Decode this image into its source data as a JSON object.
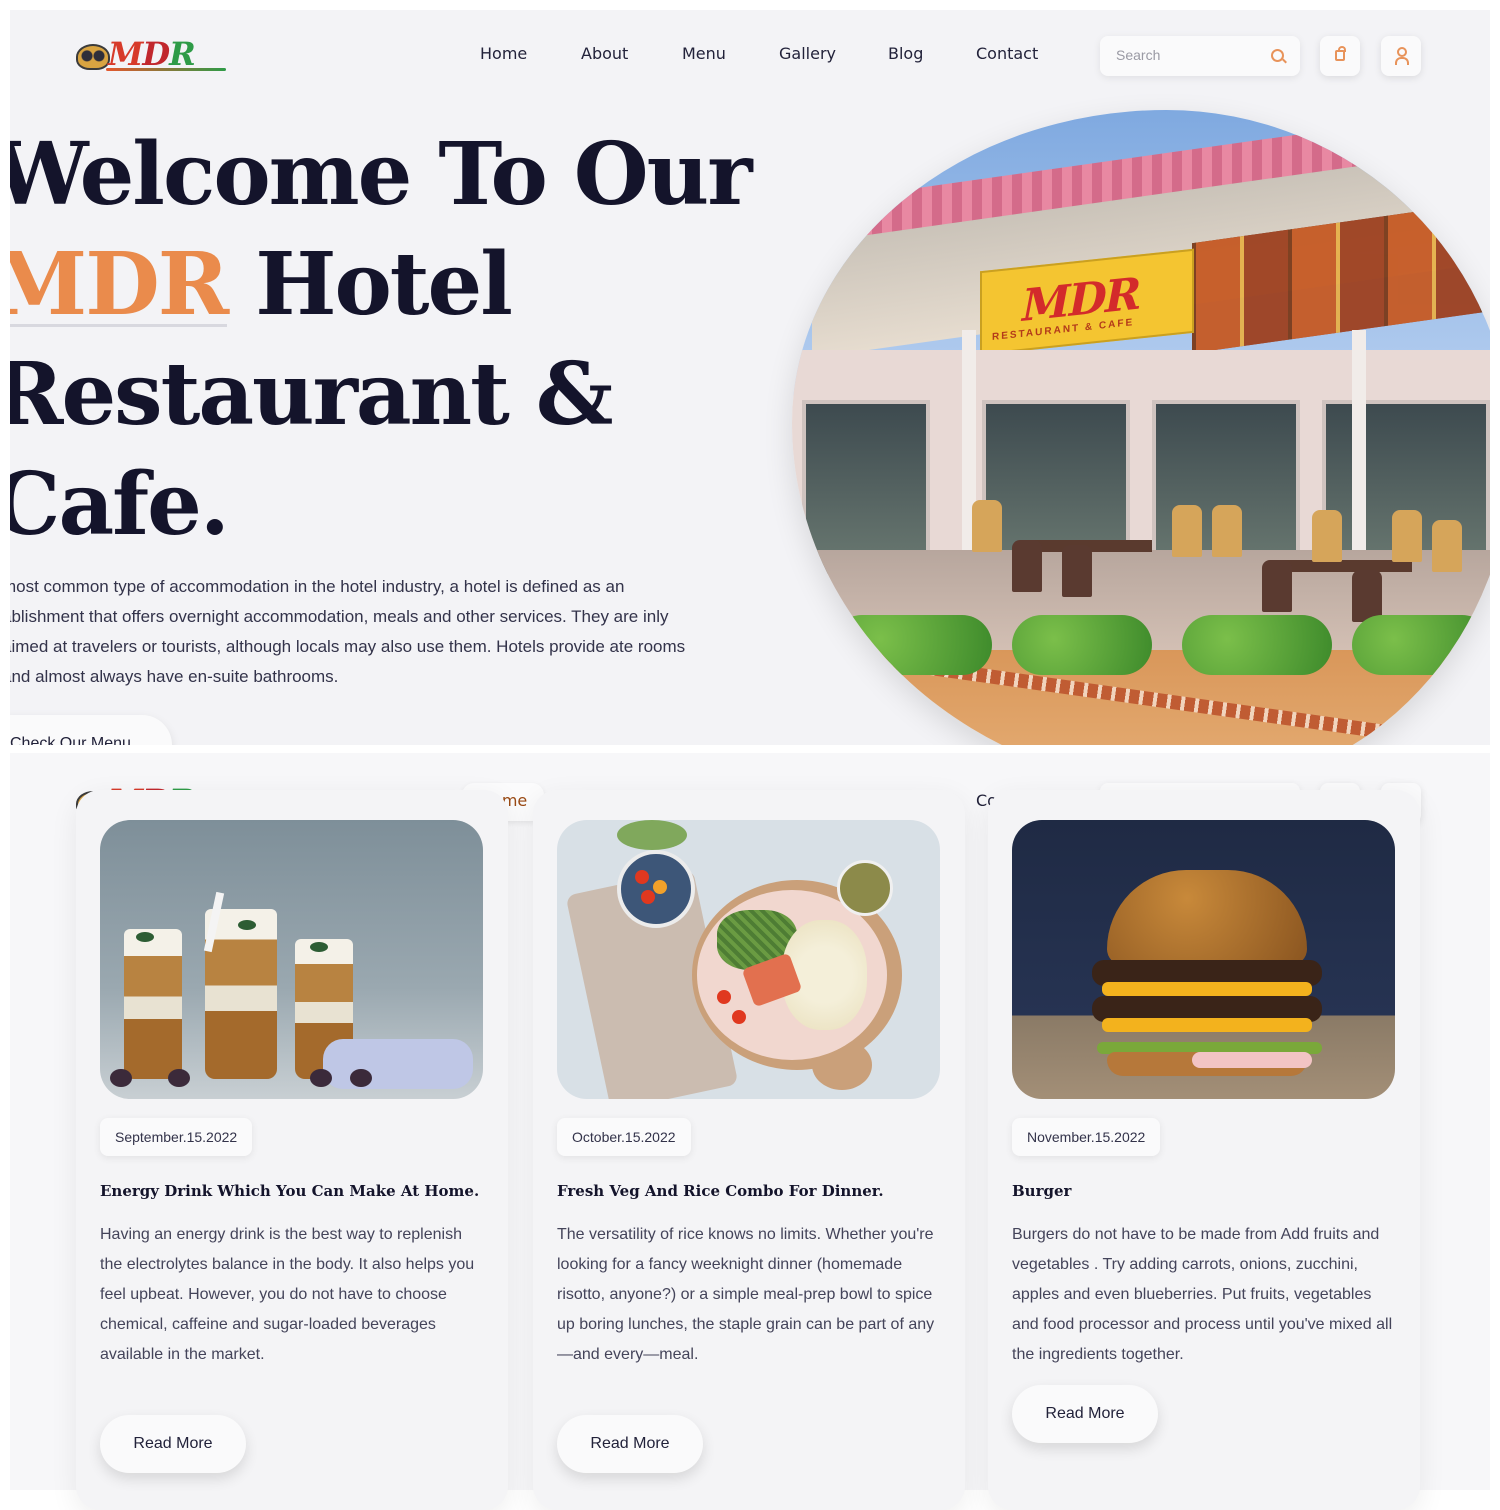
{
  "brand": {
    "logo_text_m": "M",
    "logo_text_d": "D",
    "logo_text_r": "R"
  },
  "nav": {
    "items": [
      "Home",
      "About",
      "Menu",
      "Gallery",
      "Blog",
      "Contact"
    ],
    "search_placeholder": "Search"
  },
  "hero": {
    "line1": "Welcome To Our",
    "line2_accent": "MDR",
    "line2_rest": " Hotel",
    "line3": "Restaurant &",
    "line4": "Cafe.",
    "description": "most common type of accommodation in the hotel industry, a hotel is defined as an ablishment that offers overnight accommodation, meals and other services. They are inly aimed at travelers or tourists, although locals may also use them. Hotels provide ate rooms and almost always have en-suite bathrooms.",
    "button_label": "Check Our Menu",
    "sign_text": "MDR",
    "sign_subtext": "RESTAURANT & CAFE"
  },
  "posts": [
    {
      "date": "September.15.2022",
      "title": "Energy Drink Which You Can Make At Home.",
      "body": "Having an energy drink is the best way to replenish the electrolytes balance in the body. It also helps you feel upbeat. However, you do not have to choose chemical, caffeine and sugar-loaded beverages available in the market.",
      "button": "Read More"
    },
    {
      "date": "October.15.2022",
      "title": "Fresh Veg And Rice Combo For Dinner.",
      "body": "The versatility of rice knows no limits. Whether you're looking for a fancy weeknight dinner (homemade risotto, anyone?) or a simple meal-prep bowl to spice up boring lunches, the staple grain can be part of any—and every—meal.",
      "button": "Read More"
    },
    {
      "date": "November.15.2022",
      "title": "Burger",
      "body": "Burgers do not have to be made from Add fruits and vegetables . Try adding carrots, onions, zucchini, apples and even blueberries. Put fruits, vegetables and food processor and process until you've mixed all the ingredients together.",
      "button": "Read More"
    }
  ],
  "colors": {
    "accent": "#ea8b4c",
    "heading": "#14142b",
    "background": "#f3f3f6"
  },
  "icons": {
    "search": "search-icon",
    "cart": "bag-icon",
    "user": "user-icon"
  }
}
